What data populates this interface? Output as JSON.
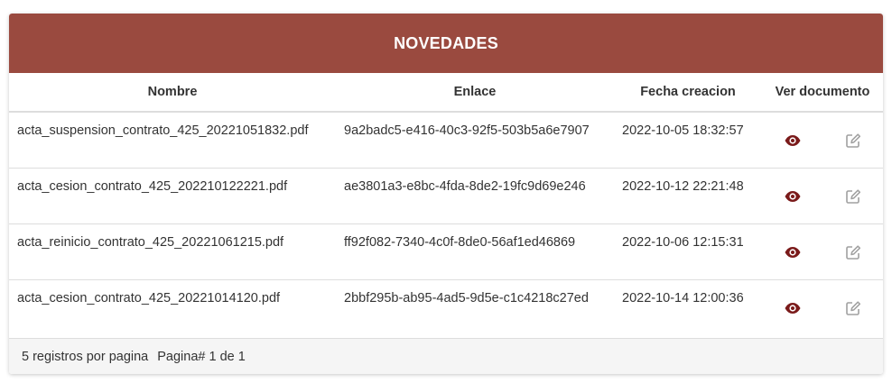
{
  "panel": {
    "title": "NOVEDADES",
    "header_color": "#9a4a3f"
  },
  "table": {
    "headers": {
      "nombre": "Nombre",
      "enlace": "Enlace",
      "fecha": "Fecha creacion",
      "ver": "Ver documento"
    },
    "rows": [
      {
        "nombre": "acta_suspension_contrato_425_20221051832.pdf",
        "enlace": "9a2badc5-e416-40c3-92f5-503b5a6e7907",
        "fecha": "2022-10-05 18:32:57"
      },
      {
        "nombre": "acta_cesion_contrato_425_202210122221.pdf",
        "enlace": "ae3801a3-e8bc-4fda-8de2-19fc9d69e246",
        "fecha": "2022-10-12 22:21:48"
      },
      {
        "nombre": "acta_reinicio_contrato_425_20221061215.pdf",
        "enlace": "ff92f082-7340-4c0f-8de0-56af1ed46869",
        "fecha": "2022-10-06 12:15:31"
      },
      {
        "nombre": "acta_cesion_contrato_425_20221014120.pdf",
        "enlace": "2bbf295b-ab95-4ad5-9d5e-c1c4218c27ed",
        "fecha": "2022-10-14 12:00:36"
      }
    ],
    "icons": {
      "view": "eye-icon",
      "edit": "edit-icon",
      "view_color": "#7a1a1a",
      "edit_color": "#a0a0a0"
    }
  },
  "footer": {
    "per_page": "5 registros por pagina",
    "page_info": "Pagina# 1 de 1"
  }
}
